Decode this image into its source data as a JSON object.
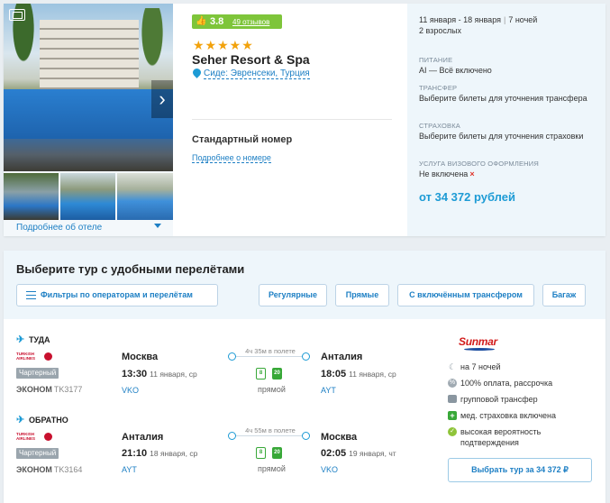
{
  "hotel": {
    "rating_score": "3.8",
    "reviews_label": "49 отзывов",
    "stars": "★★★★★",
    "name": "Seher Resort & Spa",
    "location": "Сиде: Эвренсеки, Турция",
    "more_about_hotel": "Подробнее об отеле",
    "room_type": "Стандартный номер",
    "room_more": "Подробнее о номере"
  },
  "details": {
    "dates": "11 января - 18 января",
    "nights": "7 ночей",
    "guests": "2 взрослых",
    "meal_label": "ПИТАНИЕ",
    "meal_value": "AI — Всё включено",
    "transfer_label": "ТРАНСФЕР",
    "transfer_value": "Выберите билеты для уточнения трансфера",
    "insurance_label": "СТРАХОВКА",
    "insurance_value": "Выберите билеты для уточнения страховки",
    "visa_label": "УСЛУГА ВИЗОВОГО ОФОРМЛЕНИЯ",
    "visa_value": "Не включена",
    "visa_mark": "×",
    "price_from": "от 34 372 рублей"
  },
  "tour": {
    "title": "Выберите тур с удобными перелётами",
    "filters": {
      "operators": "Фильтры по операторам и перелётам",
      "regular": "Регулярные",
      "direct": "Прямые",
      "transfer": "С включённым трансфером",
      "luggage": "Багаж"
    },
    "outbound": {
      "label": "ТУДА",
      "airline": "TURKISH AIRLINES",
      "charter": "Чартерный",
      "class": "ЭКОНОМ",
      "flight_no": "TK3177",
      "from_city": "Москва",
      "from_time": "13:30",
      "from_date": "11 января, ср",
      "from_airport": "VKO",
      "duration": "4ч 35м в полете",
      "bag1": "8",
      "bag2": "20",
      "direct": "прямой",
      "to_city": "Анталия",
      "to_time": "18:05",
      "to_date": "11 января, ср",
      "to_airport": "AYT"
    },
    "return": {
      "label": "ОБРАТНО",
      "airline": "TURKISH AIRLINES",
      "charter": "Чартерный",
      "class": "ЭКОНОМ",
      "flight_no": "TK3164",
      "from_city": "Анталия",
      "from_time": "21:10",
      "from_date": "18 января, ср",
      "from_airport": "AYT",
      "duration": "4ч 55м в полете",
      "bag1": "8",
      "bag2": "20",
      "direct": "прямой",
      "to_city": "Москва",
      "to_time": "02:05",
      "to_date": "19 января, чт",
      "to_airport": "VKO"
    },
    "operator": "Sunmar",
    "features": {
      "nights": "на 7 ночей",
      "payment": "100% оплата, рассрочка",
      "transfer": "групповой трансфер",
      "insurance": "мед. страховка включена",
      "confirmation": "высокая вероятность подтверждения"
    },
    "select_button": "Выбрать тур за 34 372 ₽"
  }
}
